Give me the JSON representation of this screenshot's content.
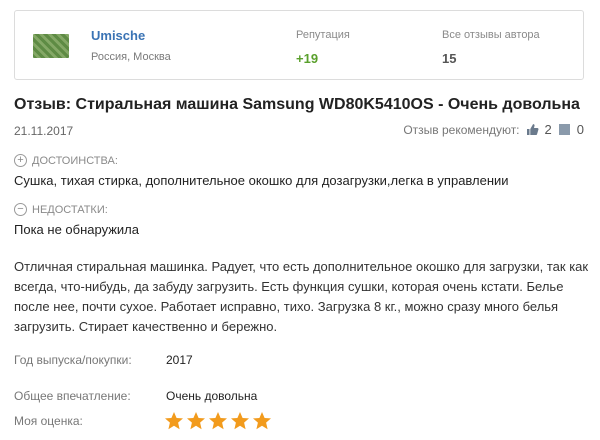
{
  "author": {
    "name": "Umische",
    "location": "Россия, Москва",
    "reputation_label": "Репутация",
    "reputation_value": "+19",
    "reviews_label": "Все отзывы автора",
    "reviews_value": "15"
  },
  "review": {
    "title": "Отзыв: Стиральная машина Samsung WD80K5410OS - Очень довольна",
    "date": "21.11.2017",
    "recommend_label": "Отзыв рекомендуют:",
    "likes": "2",
    "dislikes": "0",
    "pros_label": "ДОСТОИНСТВА:",
    "pros_text": "Сушка, тихая стирка, дополнительное окошко для дозагрузки,легка в управлении",
    "cons_label": "НЕДОСТАТКИ:",
    "cons_text": "Пока не обнаружила",
    "body": "Отличная стиральная машинка. Радует, что есть дополнительное окошко для загрузки, так как всегда, что-нибудь, да забуду загрузить. Есть функция сушки, которая очень кстати. Белье после нее, почти сухое. Работает исправно, тихо. Загрузка 8 кг., можно сразу много белья загрузить. Стирает качественно и бережно.",
    "year_label": "Год выпуска/покупки:",
    "year_value": "2017",
    "impression_label": "Общее впечатление:",
    "impression_value": "Очень довольна",
    "rating_label": "Моя оценка:",
    "rating": 5,
    "rating_max": 5
  },
  "colors": {
    "author_name": "#3a73b4",
    "reputation": "#5aa02c",
    "star": "#f29b1d"
  }
}
